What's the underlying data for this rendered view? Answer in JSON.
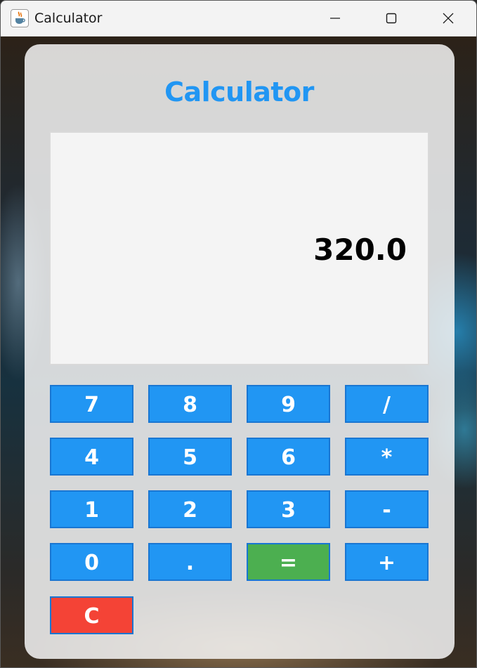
{
  "window": {
    "title": "Calculator"
  },
  "app": {
    "heading": "Calculator",
    "display_value": "320.0",
    "colors": {
      "accent": "#2196f3",
      "equals": "#4caf50",
      "clear": "#f44336",
      "display_bg": "#f4f4f4"
    }
  },
  "keys": [
    {
      "label": "7"
    },
    {
      "label": "8"
    },
    {
      "label": "9"
    },
    {
      "label": "/"
    },
    {
      "label": "4"
    },
    {
      "label": "5"
    },
    {
      "label": "6"
    },
    {
      "label": "*"
    },
    {
      "label": "1"
    },
    {
      "label": "2"
    },
    {
      "label": "3"
    },
    {
      "label": "-"
    },
    {
      "label": "0"
    },
    {
      "label": "."
    },
    {
      "label": "="
    },
    {
      "label": "+"
    },
    {
      "label": "C"
    }
  ],
  "icons": {
    "app": "java-coffee-cup-icon",
    "minimize": "minimize-icon",
    "maximize": "maximize-icon",
    "close": "close-icon"
  }
}
